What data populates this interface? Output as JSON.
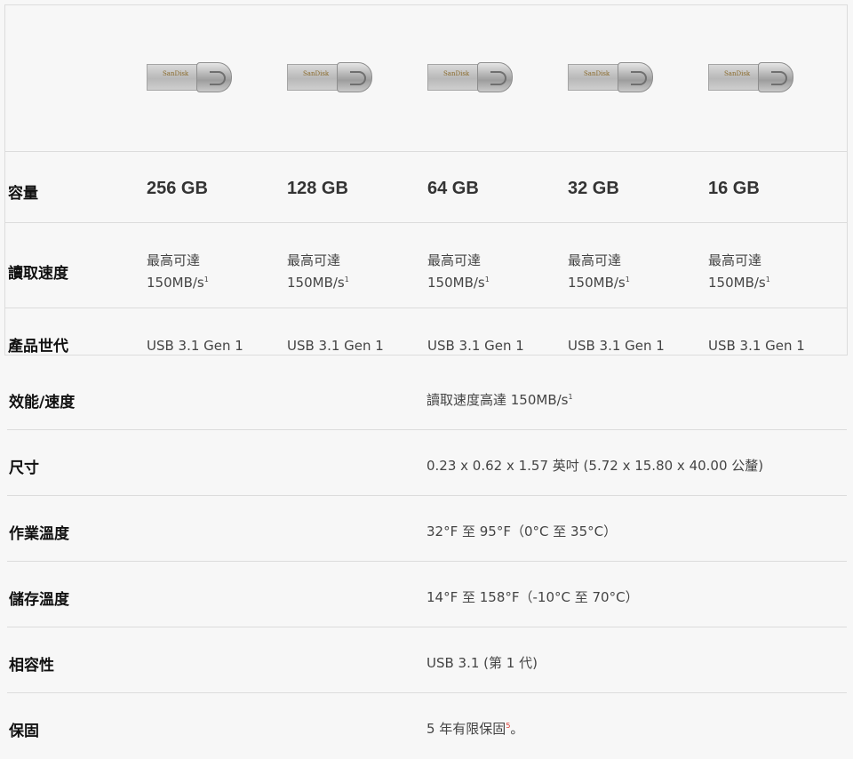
{
  "compare": {
    "brand": "SanDisk",
    "rows": {
      "capacity_label": "容量",
      "speed_label": "讀取速度",
      "gen_label": "產品世代"
    },
    "products": [
      {
        "capacity": "256 GB",
        "speed_line1": "最高可達",
        "speed_line2": "150MB/s",
        "speed_note": "1",
        "gen": "USB 3.1 Gen 1"
      },
      {
        "capacity": "128 GB",
        "speed_line1": "最高可達",
        "speed_line2": "150MB/s",
        "speed_note": "1",
        "gen": "USB 3.1 Gen 1"
      },
      {
        "capacity": "64 GB",
        "speed_line1": "最高可達",
        "speed_line2": "150MB/s",
        "speed_note": "1",
        "gen": "USB 3.1 Gen 1"
      },
      {
        "capacity": "32 GB",
        "speed_line1": "最高可達",
        "speed_line2": "150MB/s",
        "speed_note": "1",
        "gen": "USB 3.1 Gen 1"
      },
      {
        "capacity": "16 GB",
        "speed_line1": "最高可達",
        "speed_line2": "150MB/s",
        "speed_note": "1",
        "gen": "USB 3.1 Gen 1"
      }
    ]
  },
  "specs": [
    {
      "label": "效能/速度",
      "value": "讀取速度高達 150MB/s",
      "note": "1"
    },
    {
      "label": "尺寸",
      "value": "0.23 x 0.62 x 1.57 英吋 (5.72 x 15.80 x 40.00 公釐)",
      "note": ""
    },
    {
      "label": "作業溫度",
      "value": "32°F 至 95°F（0°C 至 35°C）",
      "note": ""
    },
    {
      "label": "儲存溫度",
      "value": "14°F 至 158°F（-10°C 至 70°C）",
      "note": ""
    },
    {
      "label": "相容性",
      "value": "USB 3.1 (第 1 代)",
      "note": ""
    },
    {
      "label": "保固",
      "value": "5 年有限保固",
      "note": "5",
      "suffix": "。"
    }
  ],
  "colors": {
    "note_red": "#d9342b",
    "divider": "#dcdcdc",
    "background": "#f7f7f7"
  }
}
